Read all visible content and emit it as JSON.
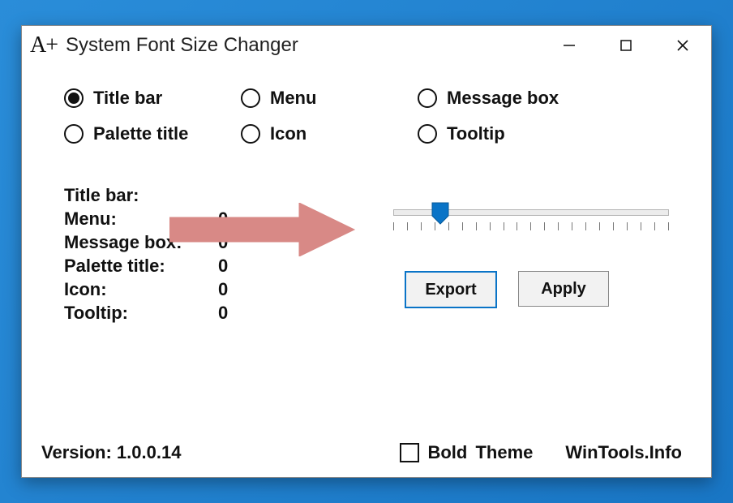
{
  "window": {
    "title": "System Font Size Changer"
  },
  "radios": {
    "title_bar": "Title bar",
    "menu": "Menu",
    "message_box": "Message box",
    "palette": "Palette title",
    "icon": "Icon",
    "tooltip": "Tooltip",
    "selected": "title_bar"
  },
  "values": {
    "title_bar": {
      "label": "Title bar:",
      "value": ""
    },
    "menu": {
      "label": "Menu:",
      "value": "0"
    },
    "message_box": {
      "label": "Message box:",
      "value": "0"
    },
    "palette": {
      "label": "Palette title:",
      "value": "0"
    },
    "icon": {
      "label": "Icon:",
      "value": "0"
    },
    "tooltip": {
      "label": "Tooltip:",
      "value": "0"
    }
  },
  "slider": {
    "position_percent": 17
  },
  "buttons": {
    "export": "Export",
    "apply": "Apply"
  },
  "footer": {
    "version": "Version: 1.0.0.14",
    "bold": "Bold",
    "bold_checked": false,
    "theme": "Theme",
    "site": "WinTools.Info"
  }
}
